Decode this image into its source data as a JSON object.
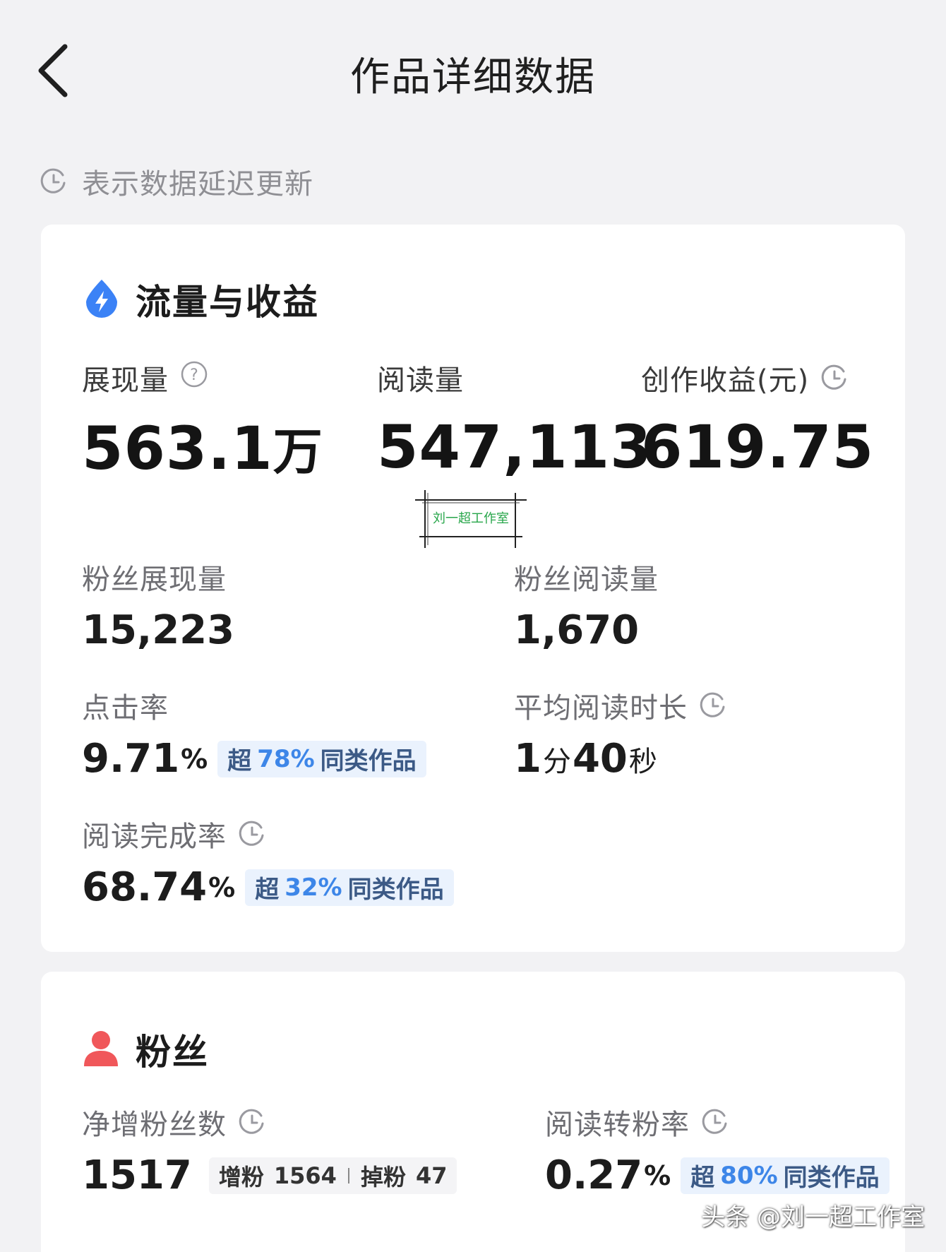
{
  "header": {
    "title": "作品详细数据"
  },
  "notice": {
    "text": "表示数据延迟更新"
  },
  "traffic": {
    "title": "流量与收益",
    "impressions": {
      "label": "展现量",
      "value": "563.1",
      "unit": "万"
    },
    "reads": {
      "label": "阅读量",
      "value": "547,113"
    },
    "earnings": {
      "label": "创作收益(元)",
      "value": "619.75"
    },
    "stamp_text": "刘一超工作室",
    "fan_impressions": {
      "label": "粉丝展现量",
      "value": "15,223"
    },
    "fan_reads": {
      "label": "粉丝阅读量",
      "value": "1,670"
    },
    "ctr": {
      "label": "点击率",
      "value": "9.71",
      "unit": "%",
      "badge": {
        "prefix": "超",
        "percent": "78%",
        "suffix": "同类作品"
      }
    },
    "avg_read_time": {
      "label": "平均阅读时长",
      "minutes": "1",
      "min_unit": "分",
      "seconds": "40",
      "sec_unit": "秒"
    },
    "completion": {
      "label": "阅读完成率",
      "value": "68.74",
      "unit": "%",
      "badge": {
        "prefix": "超",
        "percent": "32%",
        "suffix": "同类作品"
      }
    }
  },
  "fans": {
    "title": "粉丝",
    "net_gain": {
      "label": "净增粉丝数",
      "value": "1517",
      "gain_label": "增粉",
      "gain_value": "1564",
      "loss_label": "掉粉",
      "loss_value": "47"
    },
    "conversion": {
      "label": "阅读转粉率",
      "value": "0.27",
      "unit": "%",
      "badge": {
        "prefix": "超",
        "percent": "80%",
        "suffix": "同类作品"
      }
    }
  },
  "watermark": "头条 @刘一超工作室",
  "colors": {
    "background": "#f2f2f4",
    "card": "#ffffff",
    "badge_bg": "#eaf2fd",
    "badge_accent": "#3d86e8",
    "traffic_icon": "#3b82f6",
    "fans_icon": "#f0575a",
    "stamp_green": "#27a64a"
  },
  "icons": {
    "back": "chevron-left-icon",
    "delay": "clock-icon",
    "help": "question-circle-icon",
    "traffic": "lightning-drop-icon",
    "fans": "person-icon"
  }
}
